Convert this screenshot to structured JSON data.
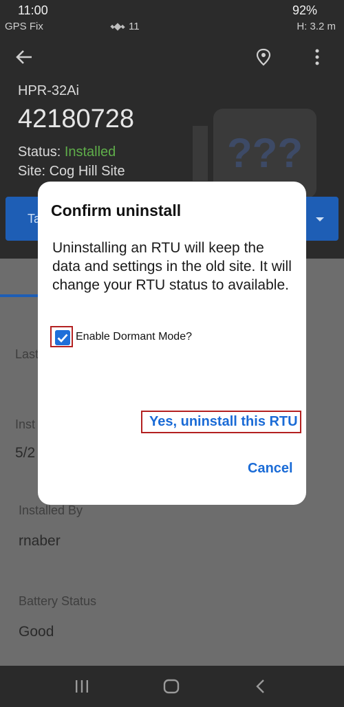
{
  "status_bar": {
    "time": "11:00",
    "battery": "92%",
    "gps_fix": "GPS Fix",
    "satellites": "11",
    "h_accuracy": "H: 3.2 m"
  },
  "header": {
    "model": "HPR-32Ai",
    "device_id": "42180728",
    "status_label": "Status: ",
    "status_value": "Installed",
    "site": "Site: Cog Hill Site",
    "action_label": "Ta"
  },
  "details": {
    "last_label": "Last",
    "installed_label": "Inst",
    "installed_value": "5/2",
    "installed_by_label": "Installed By",
    "installed_by_value": "rnaber",
    "battery_label": "Battery Status",
    "battery_value": "Good"
  },
  "dialog": {
    "title": "Confirm uninstall",
    "message": "Uninstalling an RTU will keep the data and settings in the old site. It will change your RTU status to available.",
    "checkbox_label": "Enable Dormant Mode?",
    "checkbox_checked": true,
    "confirm_label": "Yes, uninstall this RTU",
    "cancel_label": "Cancel"
  },
  "colors": {
    "accent": "#1a6bd6",
    "status_installed": "#5fae4a",
    "highlight": "#b32020"
  }
}
